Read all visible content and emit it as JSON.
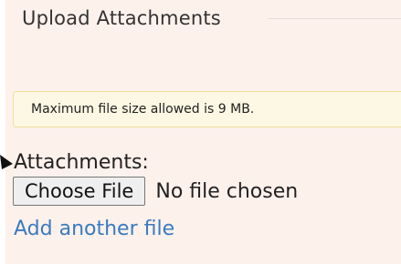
{
  "fieldset": {
    "legend": "Upload Attachments"
  },
  "alert": {
    "text": "Maximum file size allowed is 9 MB."
  },
  "attachments": {
    "label": "Attachments:",
    "choose_button_label": "Choose File",
    "file_status": "No file chosen",
    "add_another_link": "Add another file"
  },
  "colors": {
    "panel_bg": "#fdf1ec",
    "alert_bg": "#fcf8e3",
    "alert_border": "#f3df9b",
    "link": "#3a7bbf"
  },
  "icons": {
    "pointer": "pointer-arrow-icon"
  }
}
